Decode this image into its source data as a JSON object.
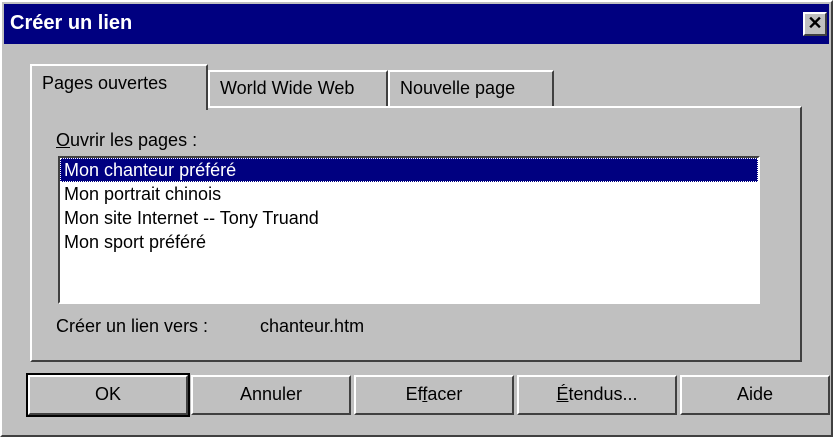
{
  "window": {
    "title": "Créer un lien",
    "close_symbol": "✕"
  },
  "tabs": [
    {
      "label": "Pages ouvertes",
      "active": true
    },
    {
      "label": "World Wide Web",
      "active": false
    },
    {
      "label": "Nouvelle page",
      "active": false
    }
  ],
  "pages_panel": {
    "list_label_accel": "O",
    "list_label_rest": "uvrir les pages :",
    "items": [
      {
        "label": "Mon chanteur préféré",
        "selected": true
      },
      {
        "label": "Mon portrait chinois",
        "selected": false
      },
      {
        "label": "Mon site Internet -- Tony Truand",
        "selected": false
      },
      {
        "label": "Mon sport préféré",
        "selected": false
      }
    ],
    "link_label": "Créer un lien vers :",
    "link_value": "chanteur.htm"
  },
  "buttons": {
    "ok": "OK",
    "cancel": "Annuler",
    "clear_pre": "Ef",
    "clear_accel": "f",
    "clear_post": "acer",
    "ext_pre": "",
    "ext_accel": "É",
    "ext_post": "tendus...",
    "help": "Aide"
  },
  "colors": {
    "titlebar": "#000080",
    "face": "#c0c0c0",
    "selection": "#000080"
  }
}
